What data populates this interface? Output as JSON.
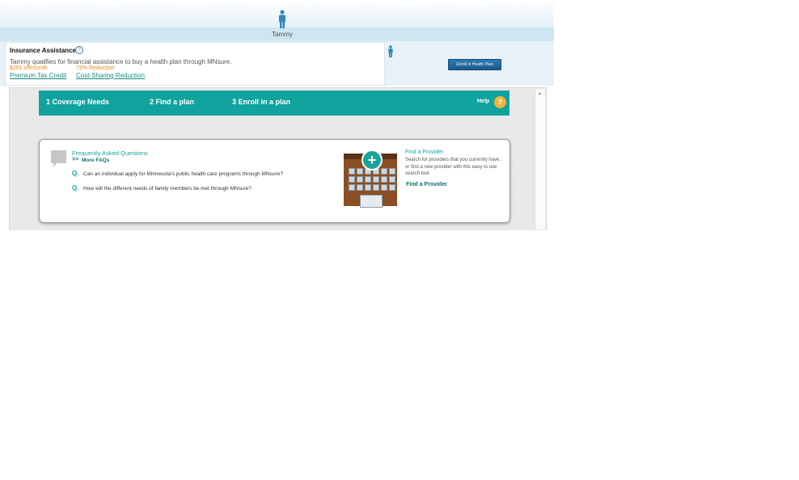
{
  "person": {
    "name": "Tammy"
  },
  "assistance": {
    "title": "Insurance Assistance",
    "help_glyph": "?",
    "description": "Tammy qualifies for financial assistance to buy a health plan through MNsure.",
    "amount_off": "$201 off/month",
    "reduction": "73% Reduction",
    "tax_credit_link": "Premium Tax Credit",
    "cost_sharing_link": "Cost-Sharing Reduction",
    "enroll_button": "Enroll in Health Plan"
  },
  "steps": [
    {
      "label": "1  Coverage Needs"
    },
    {
      "label": "2  Find a plan"
    },
    {
      "label": "3  Enroll in a plan"
    }
  ],
  "help": {
    "label": "Help",
    "glyph": "?"
  },
  "faq": {
    "title": "Frequently Asked Questions",
    "more_link": "More FAQs",
    "q_marker": "Q.",
    "questions": [
      "Can an individual apply for Minnesota's public health care programs through MNsure?",
      "How will the different needs of family members be met through MNsure?"
    ]
  },
  "provider": {
    "title": "Find a Provider",
    "description": "Search for providers that you currently have, or find a new provider with this easy to use search tool.",
    "link": "Find a Provider"
  },
  "colors": {
    "teal": "#10a39e",
    "orange": "#e38a24",
    "help_yellow": "#f0b43a",
    "enroll_blue": "#1c5a8a"
  },
  "icons": [
    "person-icon",
    "help-icon",
    "speech-bubble-icon",
    "chevron-right-icon",
    "hospital-icon",
    "scroll-up-arrow-icon"
  ]
}
